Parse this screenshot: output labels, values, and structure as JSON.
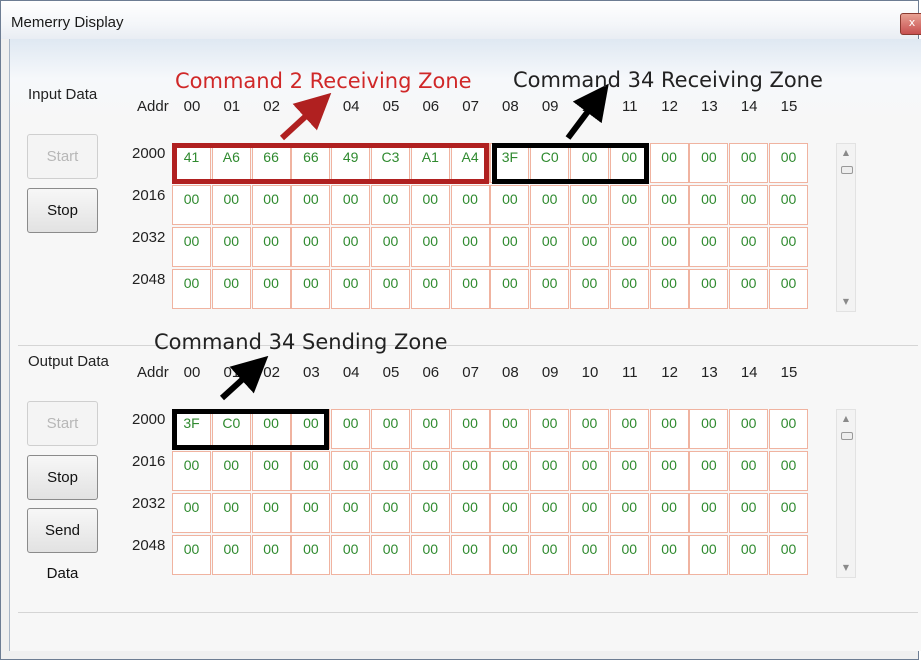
{
  "window": {
    "title": "Memerry Display",
    "close_glyph": "x"
  },
  "columns": [
    "00",
    "01",
    "02",
    "03",
    "04",
    "05",
    "06",
    "07",
    "08",
    "09",
    "10",
    "11",
    "12",
    "13",
    "14",
    "15"
  ],
  "addr_label": "Addr",
  "input": {
    "label": "Input Data",
    "buttons": {
      "start": "Start",
      "stop": "Stop"
    },
    "rows": [
      {
        "addr": "2000",
        "cells": [
          "41",
          "A6",
          "66",
          "66",
          "49",
          "C3",
          "A1",
          "A4",
          "3F",
          "C0",
          "00",
          "00",
          "00",
          "00",
          "00",
          "00"
        ]
      },
      {
        "addr": "2016",
        "cells": [
          "00",
          "00",
          "00",
          "00",
          "00",
          "00",
          "00",
          "00",
          "00",
          "00",
          "00",
          "00",
          "00",
          "00",
          "00",
          "00"
        ]
      },
      {
        "addr": "2032",
        "cells": [
          "00",
          "00",
          "00",
          "00",
          "00",
          "00",
          "00",
          "00",
          "00",
          "00",
          "00",
          "00",
          "00",
          "00",
          "00",
          "00"
        ]
      },
      {
        "addr": "2048",
        "cells": [
          "00",
          "00",
          "00",
          "00",
          "00",
          "00",
          "00",
          "00",
          "00",
          "00",
          "00",
          "00",
          "00",
          "00",
          "00",
          "00"
        ]
      }
    ]
  },
  "output": {
    "label": "Output Data",
    "buttons": {
      "start": "Start",
      "stop": "Stop",
      "send": "Send Data"
    },
    "rows": [
      {
        "addr": "2000",
        "cells": [
          "3F",
          "C0",
          "00",
          "00",
          "00",
          "00",
          "00",
          "00",
          "00",
          "00",
          "00",
          "00",
          "00",
          "00",
          "00",
          "00"
        ]
      },
      {
        "addr": "2016",
        "cells": [
          "00",
          "00",
          "00",
          "00",
          "00",
          "00",
          "00",
          "00",
          "00",
          "00",
          "00",
          "00",
          "00",
          "00",
          "00",
          "00"
        ]
      },
      {
        "addr": "2032",
        "cells": [
          "00",
          "00",
          "00",
          "00",
          "00",
          "00",
          "00",
          "00",
          "00",
          "00",
          "00",
          "00",
          "00",
          "00",
          "00",
          "00"
        ]
      },
      {
        "addr": "2048",
        "cells": [
          "00",
          "00",
          "00",
          "00",
          "00",
          "00",
          "00",
          "00",
          "00",
          "00",
          "00",
          "00",
          "00",
          "00",
          "00",
          "00"
        ]
      }
    ]
  },
  "annotations": {
    "cmd2_receiving": "Command 2 Receiving Zone",
    "cmd34_receiving": "Command 34 Receiving Zone",
    "cmd34_sending": "Command 34 Sending Zone"
  },
  "colors": {
    "cell_text": "#2f8a2f",
    "cell_border": "#f0b3a0",
    "cmd2_zone": "#b02020",
    "cmd34_zone": "#000000"
  }
}
